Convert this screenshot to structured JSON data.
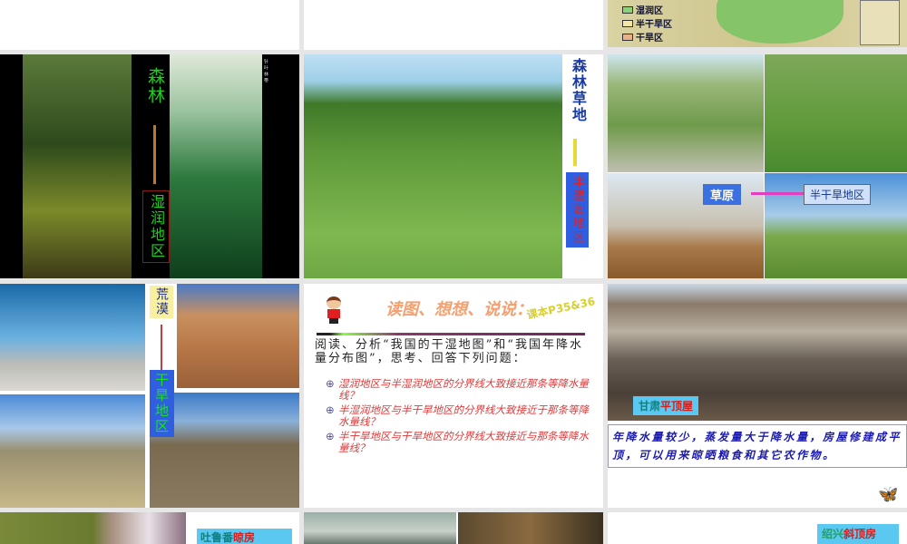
{
  "slides": [
    {
      "id": "s1"
    },
    {
      "id": "s2"
    },
    {
      "id": "s3",
      "legend": [
        "湿润区",
        "半干旱区",
        "干旱区"
      ],
      "legend_colors": [
        "#8fd07a",
        "#f2e6a8",
        "#eab08a"
      ]
    },
    {
      "id": "s4",
      "top_label": "森林",
      "bottom_label": "湿润地区",
      "caption": "针叶林带"
    },
    {
      "id": "s5",
      "top_label": "森林草地",
      "bottom_label": "半湿润地区"
    },
    {
      "id": "s6",
      "left_label": "草原",
      "right_label": "半干旱地区"
    },
    {
      "id": "s7",
      "top_label": "荒漠",
      "bottom_label": "干旱地区"
    },
    {
      "id": "s8",
      "title": "读图、想想、说说：",
      "ref": "课本P35&36",
      "intro": "阅读、分析“我国的干湿地图”和“我国年降水量分布图”，思考、回答下列问题：",
      "questions": [
        "湿润地区与半湿润地区的分界线大致接近那条等降水量线？",
        "半湿润地区与半干旱地区的分界线大致接近于那条等降水量线？",
        "半干旱地区与干旱地区的分界线大致接近与那条等降水量线？"
      ]
    },
    {
      "id": "s9",
      "label_a": "甘肃",
      "label_b": "平顶屋",
      "text": "年降水量较少，蒸发量大于降水量，房屋修建成平顶，可以用来晾晒粮食和其它农作物。"
    },
    {
      "id": "s10",
      "label_a": "吐鲁番",
      "label_b": "晾房"
    },
    {
      "id": "s11"
    },
    {
      "id": "s12",
      "label_a": "绍兴",
      "label_b": "斜顶房"
    }
  ]
}
